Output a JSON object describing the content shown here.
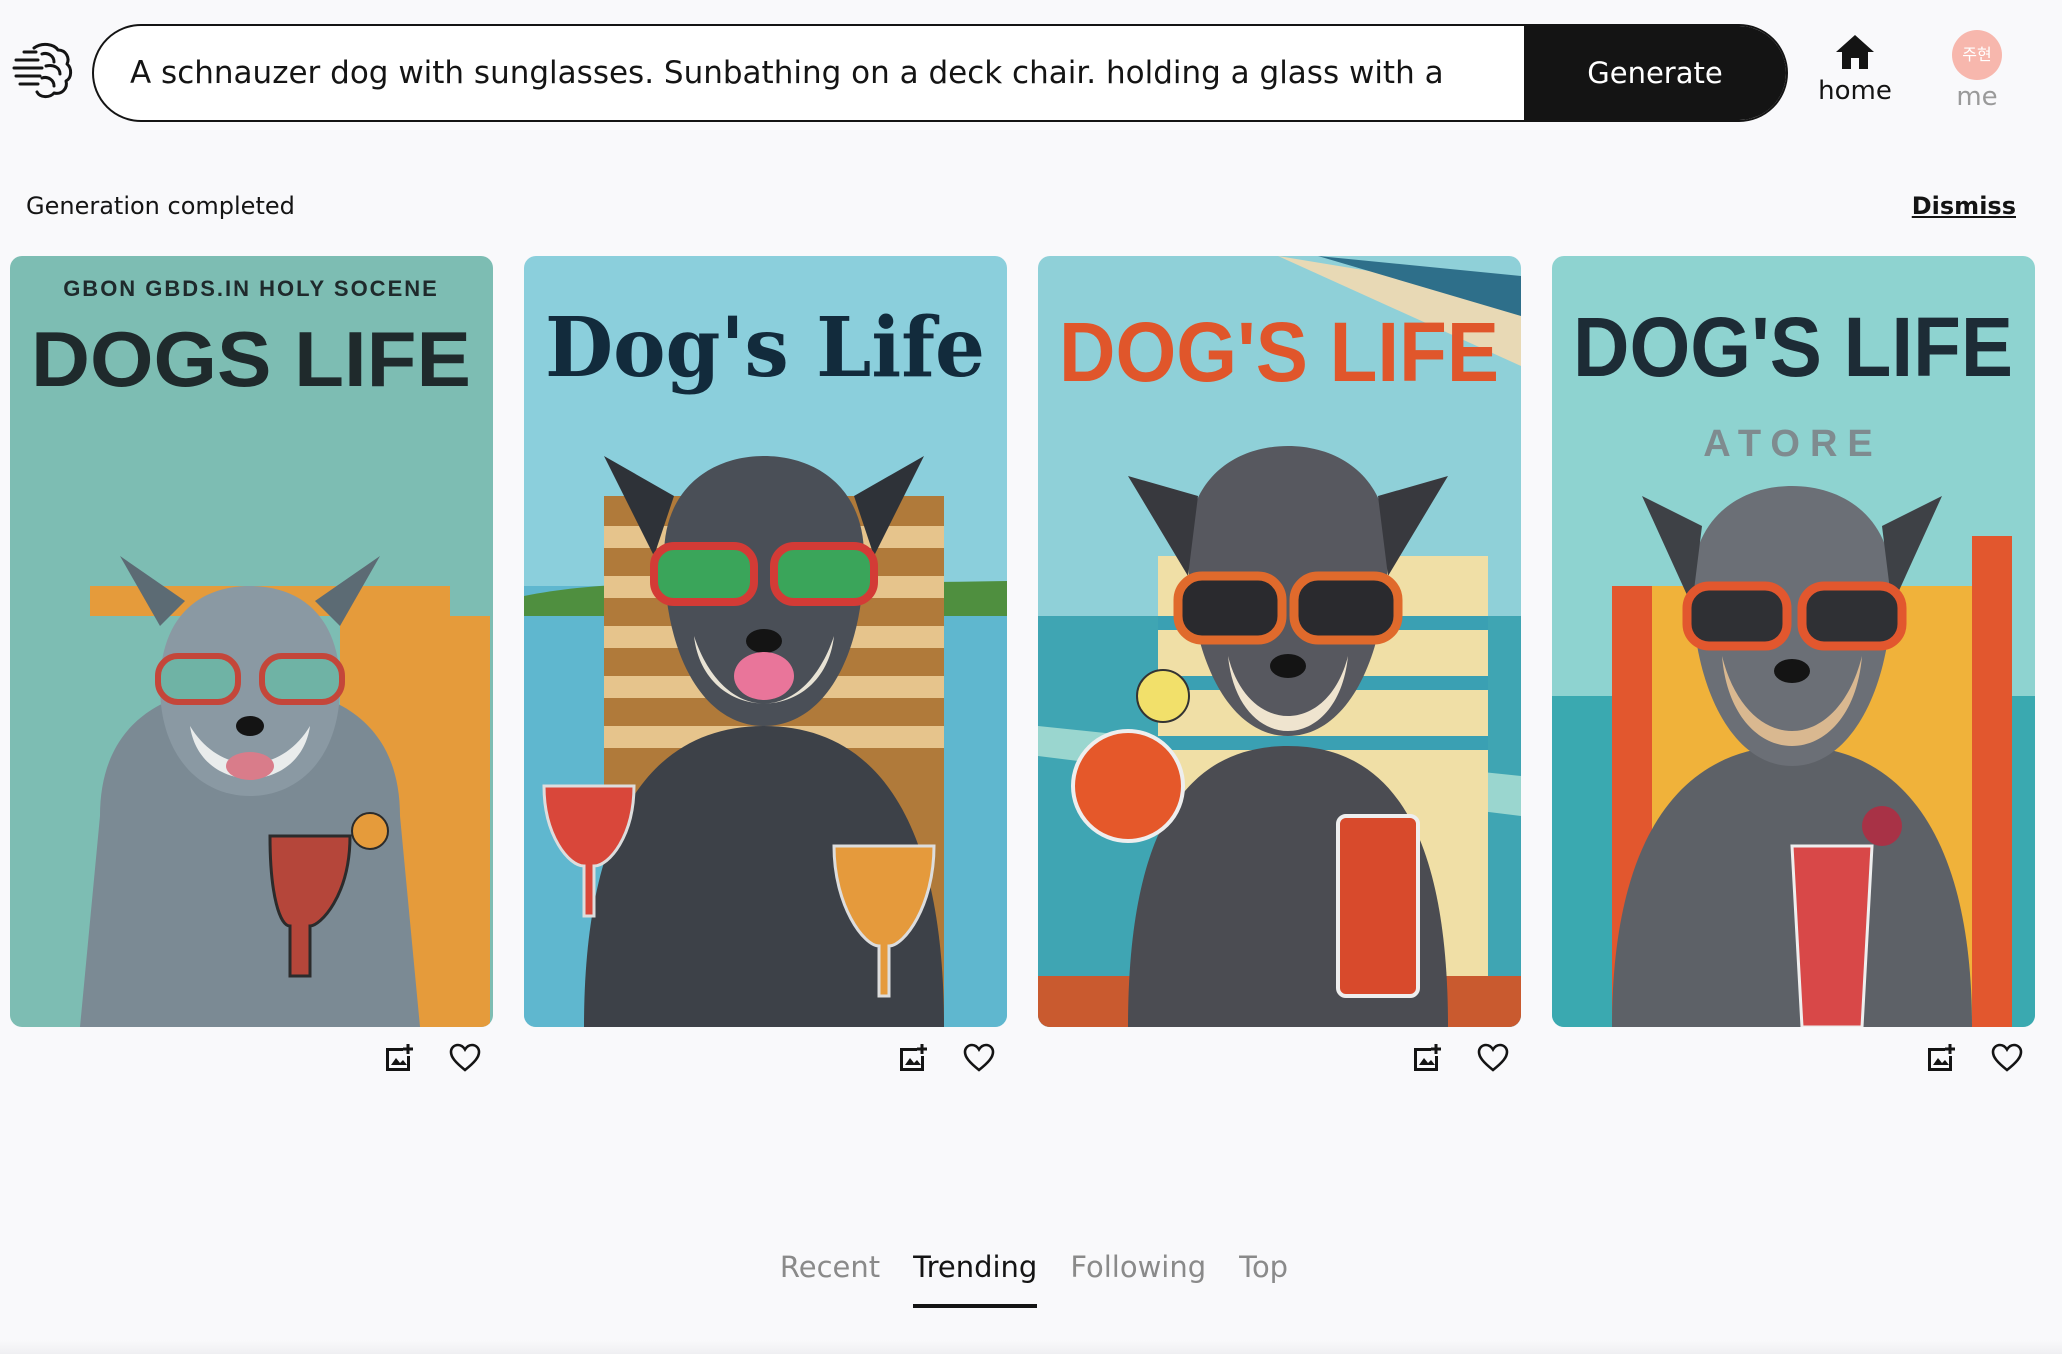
{
  "header": {
    "logo_icon": "brain-icon",
    "prompt_value": "A schnauzer dog with sunglasses. Sunbathing on a deck chair. holding a glass with a",
    "generate_label": "Generate",
    "nav": {
      "home_label": "home",
      "home_icon": "home-icon",
      "me_label": "me",
      "avatar_text": "주현",
      "avatar_color": "#f7b7ad"
    }
  },
  "status": {
    "message": "Generation completed",
    "dismiss_label": "Dismiss"
  },
  "results": [
    {
      "image_text": "DOGS LIFE",
      "image_subtext": "GBON GBDS.IN HOLY SOCENE",
      "actions": [
        "add-image-icon",
        "heart-icon"
      ]
    },
    {
      "image_text": "Dog's Life",
      "actions": [
        "add-image-icon",
        "heart-icon"
      ]
    },
    {
      "image_text": "DOG'S LIFE",
      "actions": [
        "add-image-icon",
        "heart-icon"
      ]
    },
    {
      "image_text": "DOG'S LIFE",
      "image_subtext": "ATORE",
      "actions": [
        "add-image-icon",
        "heart-icon"
      ]
    }
  ],
  "tabs": [
    {
      "label": "Recent",
      "active": false
    },
    {
      "label": "Trending",
      "active": true
    },
    {
      "label": "Following",
      "active": false
    },
    {
      "label": "Top",
      "active": false
    }
  ],
  "colors": {
    "background": "#f9f9fb",
    "primary": "#141414",
    "inactive_tab": "#8a8a8a"
  }
}
